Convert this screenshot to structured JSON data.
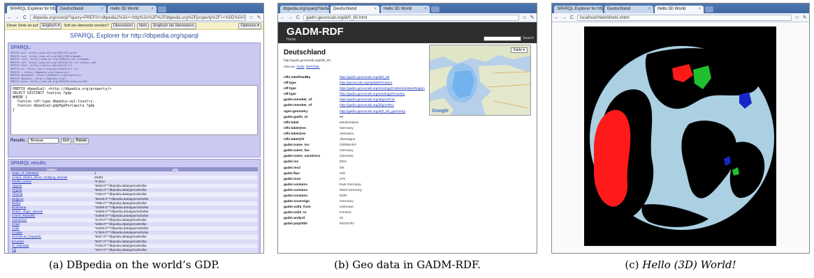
{
  "captions": [
    {
      "label": "(a)",
      "text": "DBpedia on the world’s GDP."
    },
    {
      "label": "(b)",
      "text": "Geo data in GADM-RDF."
    },
    {
      "label": "(c)",
      "text": "Hello (3D) World!"
    }
  ],
  "panel_a": {
    "tabs": [
      "SPARQL Explorer for http:",
      "Deutschland",
      "Hello 3D World"
    ],
    "url": "dbpedia.org/snorql/?query=PREFIX+dbpedia2%3A+<http%3A%2F%2Fdbpedia.org%2Fproperty%2F>+%0D%0ASELECT+DISTINCT",
    "translate_bar": {
      "lead": "Diese Seite ist auf",
      "lang": "Englisch ▾",
      "question": "Soll sie übersetzt werden?",
      "translate": "Übersetzen",
      "no": "Nein",
      "never": "Englisch nie übersetzen",
      "options": "Optionen ▾"
    },
    "page_title": "SPARQL Explorer for http://dbpedia.org/sparql",
    "sparql_label": "SPARQL:",
    "prefixes": "PREFIX owl: <http://www.w3.org/2002/07/owl#>\nPREFIX xsd: <http://www.w3.org/2001/XMLSchema#>\nPREFIX rdfs: <http://www.w3.org/2000/01/rdf-schema#>\nPREFIX rdf: <http://www.w3.org/1999/02/22-rdf-syntax-ns#>\nPREFIX foaf: <http://xmlns.com/foaf/0.1/>\nPREFIX dc: <http://purl.org/dc/elements/1.1/>\nPREFIX : <http://dbpedia.org/resource/>\nPREFIX dbpedia2: <http://dbpedia.org/property/>\nPREFIX dbpedia: <http://dbpedia.org/>\nPREFIX skos: <http://www.w3.org/2004/02/skos/core#>",
    "query": "PREFIX dbpedia2: <http://dbpedia.org/property/>\nSELECT DISTINCT ?nation ?gdp\nWHERE {\n  ?nation rdf:type dbpedia-owl:Country.\n  ?nation dbpedia2:gdpPppPerCapita ?gdp\n}",
    "results_label": "Results:",
    "results_select": "Browse",
    "go": "Go!",
    "reset": "Reset",
    "results_heading": "SPARQL results:",
    "columns": [
      "nation",
      "gdp"
    ],
    "rows": [
      [
        "State_of_Palestine",
        "1"
      ],
      [
        "United_States_Minor_Outlying_Islands",
        "46381"
      ],
      [
        "Pacific_Union",
        "\"5\"@en"
      ],
      [
        "Algeria",
        "\"6949.0\"^^dbpedia.datatype/usDollar"
      ],
      [
        "Angola",
        "\"5632.0\"^^dbpedia.datatype/usDollar"
      ],
      [
        "Albania",
        "\"7453.0\"^^dbpedia.datatype/usDollar"
      ],
      [
        "Belgium",
        "\"36193.0\"^^dbpedia.datatype/usDollar"
      ],
      [
        "Belize",
        "\"7895.0\"^^dbpedia.datatype/usDollar"
      ],
      [
        "Botswana",
        "\"15489.0\"^^dbpedia.datatype/usDollar"
      ],
      [
        "British_Virgin_Islands",
        "\"43366.0\"^^dbpedia.datatype/usDollar"
      ],
      [
        "Czech_Republic",
        "\"24869.0\"^^dbpedia.datatype/usDollar"
      ],
      [
        "Cameroon",
        "\"2176.0\"^^dbpedia.datatype/usDollar"
      ],
      [
        "Chad",
        "\"1696.0\"^^dbpedia.datatype/usDollar"
      ],
      [
        "Chile",
        "\"15002.0\"^^dbpedia.datatype/usDollar"
      ],
      [
        "Croatia",
        "\"17663.0\"^^dbpedia.datatype/usDollar"
      ],
      [
        "Dominican_Republic",
        "\"9207.0\"^^dbpedia.datatype/usDollar"
      ],
      [
        "Ecuador",
        "\"8327.0\"^^dbpedia.datatype/usDollar"
      ],
      [
        "El_Salvador",
        "\"7429.0\"^^dbpedia.datatype/usDollar"
      ],
      [
        "Fiji",
        "\"4347.0\"^^dbpedia.datatype/usDollar"
      ],
      [
        "Azerbaijan",
        "\"16340.0\"^^dbpedia.datatype/usDollar"
      ],
      [
        "Antigua_and_Barbuda",
        "\"16573.0\"^^dbpedia.datatype/usDollar"
      ]
    ]
  },
  "panel_b": {
    "tabs": [
      "dbpedia.org/sparql?default",
      "Deutschland",
      "Hello 3D World"
    ],
    "url": "gadm.geovocab.org/id/0_60.html",
    "site_title": "GADM-RDF",
    "home": "Home",
    "search": "Search",
    "heading": "Deutschland",
    "uri": "http://gadm.geovocab.org/id/0_60",
    "view_as": "View as:",
    "view_links": [
      "Turtle",
      "RDF/XML"
    ],
    "map_button": "Karte ▾",
    "map_logo": "Google",
    "properties": [
      {
        "k": "rdfs:isDefinedBy",
        "v": "http://gadm.geovocab.org/id/0_60",
        "link": true
      },
      {
        "k": "rdf:type",
        "v": "http://geovocab.org/spatial#Feature",
        "link": true
      },
      {
        "k": "rdf:type",
        "v": "http://gadm.geovocab.org/ontology#AdministrativeRegion",
        "link": true
      },
      {
        "k": "rdf:type",
        "v": "http://gadm.geovocab.org/ontology#Country",
        "link": true
      },
      {
        "k": "gadm:member_of",
        "v": "http://gadm.geovocab.org/id/gov#CIS",
        "link": true
      },
      {
        "k": "gadm:member_of",
        "v": "http://gadm.geovocab.org/id/gov#EU",
        "link": true
      },
      {
        "k": "ngeo:geometry",
        "v": "http://gadm.geovocab.org/id/0_60_geometry",
        "link": true
      },
      {
        "k": "gadm:gadm_id",
        "v": "60",
        "link": false
      },
      {
        "k": "rdfs:label",
        "v": "Deutschland",
        "link": false
      },
      {
        "k": "rdfs:label@en",
        "v": "Germany",
        "link": false
      },
      {
        "k": "rdfs:label@es",
        "v": "Alemania",
        "link": false
      },
      {
        "k": "rdfs:label@fr",
        "v": "Allemagne",
        "link": false
      },
      {
        "k": "gadm:name_iso",
        "v": "GERMANY",
        "link": false
      },
      {
        "k": "gadm:name_fao",
        "v": "Germany",
        "link": false
      },
      {
        "k": "gadm:name_variations",
        "v": "Germany",
        "link": false
      },
      {
        "k": "gadm:iso",
        "v": "DEU",
        "link": false
      },
      {
        "k": "gadm:iso2",
        "v": "DE",
        "link": false
      },
      {
        "k": "gadm:fips",
        "v": "GM",
        "link": false
      },
      {
        "k": "gadm:ison",
        "v": "276",
        "link": false
      },
      {
        "k": "gadm:contains",
        "v": "East Germany",
        "link": false
      },
      {
        "k": "gadm:contains",
        "v": "West Germany",
        "link": false
      },
      {
        "k": "gadm:contains",
        "v": "DDR",
        "link": false
      },
      {
        "k": "gadm:sovereign",
        "v": "Germany",
        "link": false
      },
      {
        "k": "gadm:valid_from",
        "v": "Unknown",
        "link": false
      },
      {
        "k": "gadm:valid_to",
        "v": "Present",
        "link": false
      },
      {
        "k": "gadm:andyrd",
        "v": "91",
        "link": false
      },
      {
        "k": "gadm:pop2000",
        "v": "82010767",
        "link": false
      }
    ]
  },
  "panel_c": {
    "tabs": [
      "SPARQL Explorer for http:",
      "Deutschland",
      "Hello 3D World"
    ],
    "url": "localhost/HelloWorld.xhtml",
    "colors": {
      "ocean": "#aad0e2",
      "land": "#000000",
      "highlight_red": "#ff1a1a",
      "highlight_green": "#1fbf2f",
      "highlight_blue": "#1428c8"
    }
  }
}
